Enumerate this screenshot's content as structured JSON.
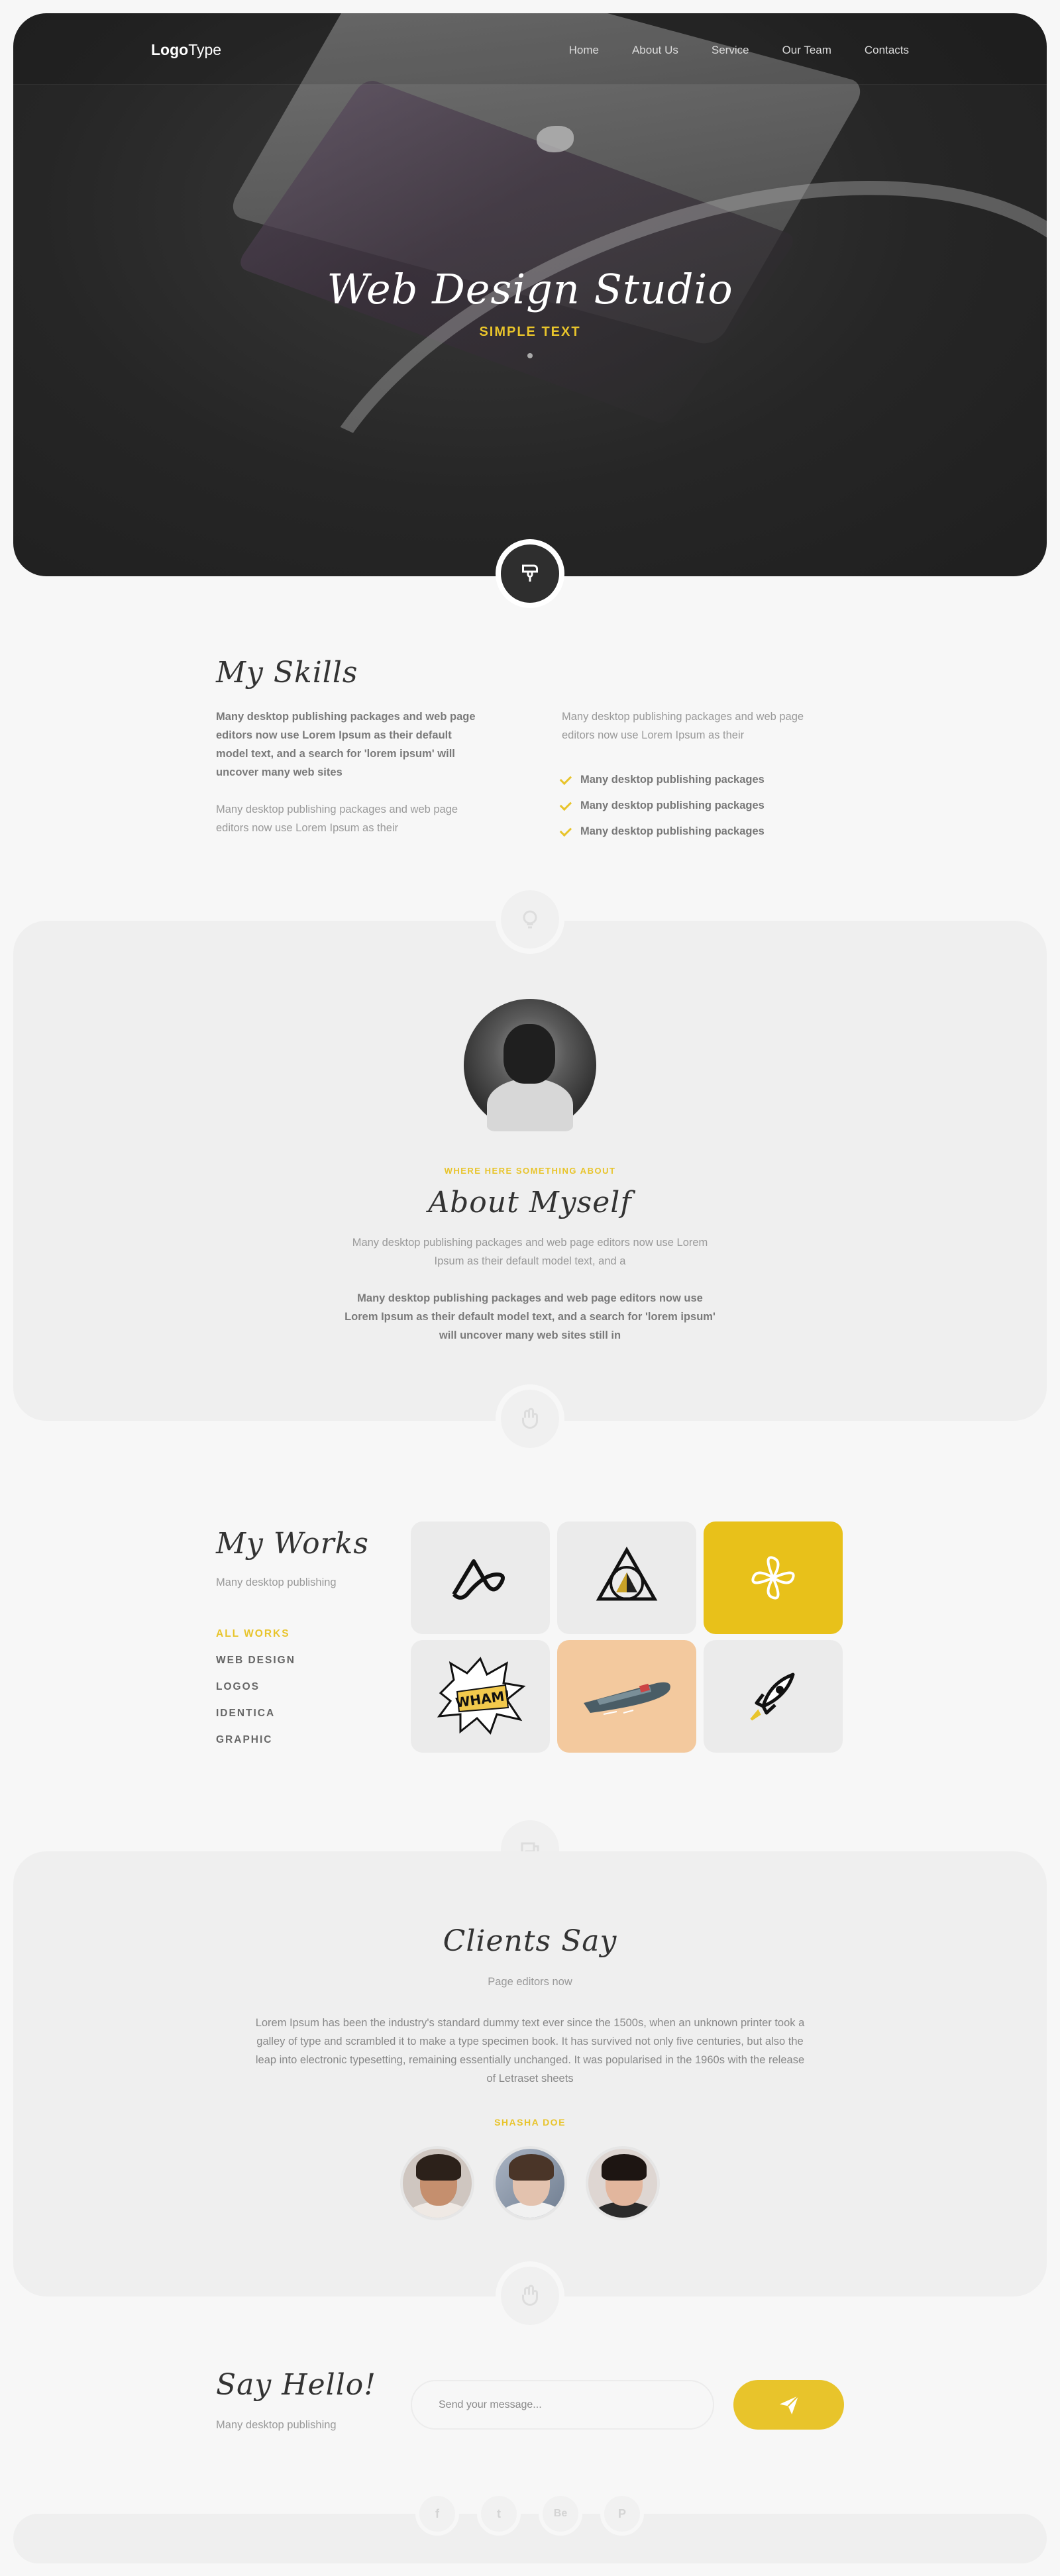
{
  "header": {
    "logo_bold": "Logo",
    "logo_light": "Type",
    "nav": [
      "Home",
      "About Us",
      "Service",
      "Our Team",
      "Contacts"
    ]
  },
  "hero": {
    "title": "Web Design Studio",
    "subtitle": "SIMPLE TEXT"
  },
  "skills": {
    "title": "My Skills",
    "para1": "Many desktop publishing packages and web page editors now use Lorem Ipsum as their default model text, and a search for 'lorem ipsum' will uncover many web sites",
    "para2": "Many desktop publishing packages and web page editors now use Lorem Ipsum as their",
    "para3": "Many desktop publishing packages and web page editors now use Lorem Ipsum as their",
    "list": [
      "Many desktop publishing packages",
      "Many desktop publishing packages",
      "Many desktop publishing packages"
    ]
  },
  "about": {
    "kicker": "WHERE HERE SOMETHING ABOUT",
    "title": "About Myself",
    "para1": "Many desktop publishing packages and web page editors now use Lorem Ipsum as their default model text, and a",
    "para2": "Many desktop publishing packages and web page editors now use Lorem Ipsum as their default model text, and a search for 'lorem ipsum' will uncover many web sites still in"
  },
  "works": {
    "title": "My Works",
    "subtitle": "Many desktop publishing",
    "filters": [
      "ALL WORKS",
      "WEB DESIGN",
      "LOGOS",
      "IDENTICA",
      "GRAPHIC"
    ],
    "active_filter": "ALL WORKS",
    "tiles": [
      {
        "icon": "wave-knot-logo-icon",
        "bg": "#ebebeb"
      },
      {
        "icon": "triangle-circle-logo-icon",
        "bg": "#ebebeb"
      },
      {
        "icon": "propeller-logo-icon",
        "bg": "#e8c11a"
      },
      {
        "icon": "wham-comic-icon",
        "bg": "#ebebeb",
        "text": "WHAM!"
      },
      {
        "icon": "boat-illustration-icon",
        "bg": "#f3c99e"
      },
      {
        "icon": "rocket-icon",
        "bg": "#ebebeb"
      }
    ]
  },
  "clients": {
    "title": "Clients Say",
    "subtitle": "Page editors now",
    "quote": "Lorem Ipsum has been the industry's standard dummy text ever since the 1500s, when an unknown printer took a galley of type and scrambled it to make a type specimen book. It has survived not only five centuries, but also the leap into electronic typesetting, remaining essentially unchanged. It was popularised in the 1960s with the release of Letraset sheets",
    "author": "SHASHA DOE"
  },
  "contact": {
    "title": "Say Hello!",
    "subtitle": "Many desktop publishing",
    "placeholder": "Send your message..."
  },
  "social": [
    "f",
    "t",
    "Be",
    "P"
  ],
  "colors": {
    "accent": "#e8c42b",
    "hero_bg": "#262626",
    "page_bg": "#f7f7f7",
    "band_bg": "#efefef"
  }
}
